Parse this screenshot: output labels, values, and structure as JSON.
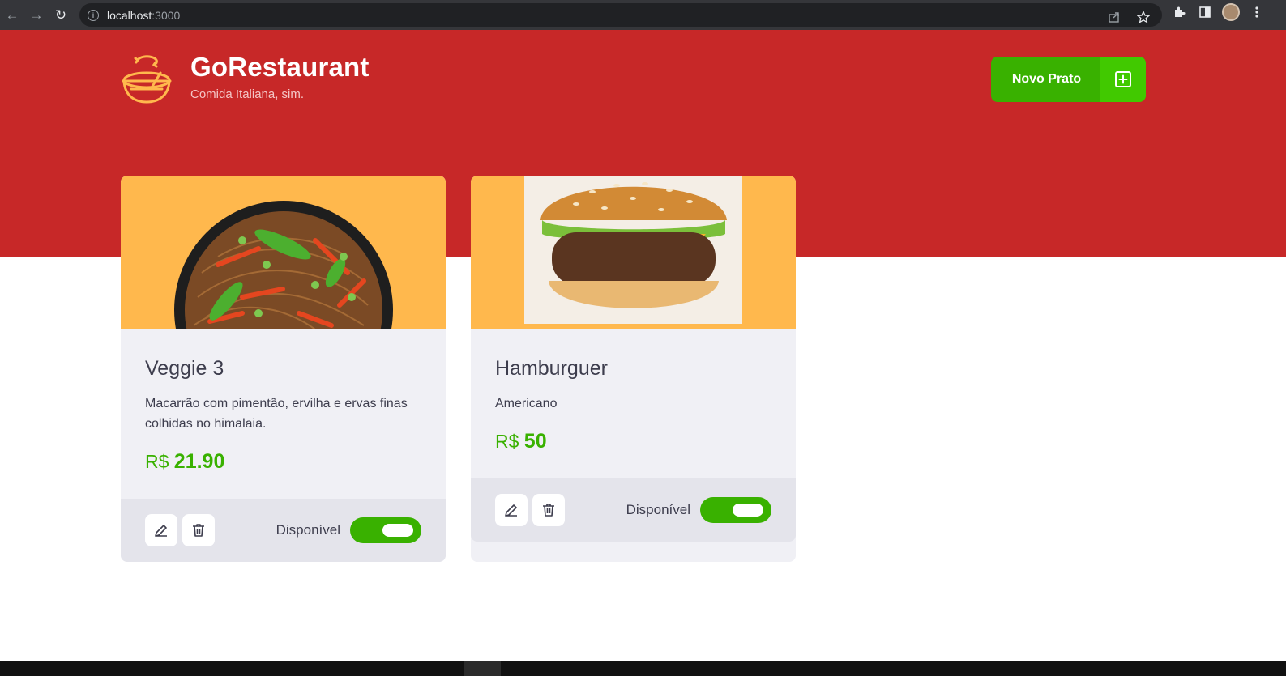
{
  "browser": {
    "url_host": "localhost",
    "url_port": ":3000"
  },
  "header": {
    "title": "GoRestaurant",
    "subtitle": "Comida Italiana, sim.",
    "new_button_label": "Novo Prato"
  },
  "colors": {
    "header_bg": "#c72828",
    "accent_green": "#39b100",
    "card_image_bg": "#ffb84d",
    "card_bg": "#f0f0f5"
  },
  "foods": [
    {
      "name": "Veggie 3",
      "description": "Macarrão com pimentão, ervilha e ervas finas colhidas no himalaia.",
      "currency": "R$",
      "price": "21.90",
      "available_label": "Disponível",
      "available": true
    },
    {
      "name": "Hamburguer",
      "description": "Americano",
      "currency": "R$",
      "price": "50",
      "available_label": "Disponível",
      "available": true
    }
  ]
}
